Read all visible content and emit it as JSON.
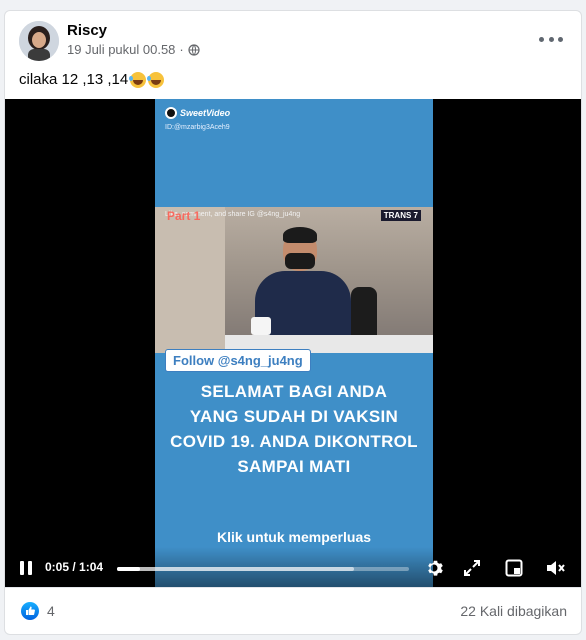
{
  "post": {
    "author": "Riscy",
    "timestamp": "19 Juli pukul 00.58",
    "privacy_icon": "globe-icon",
    "menu_icon": "more-options-icon",
    "text": "cilaka 12 ,13 ,14"
  },
  "video": {
    "brand": "SweetVideo",
    "brand_sub": "ID:@mzarbig3Aceh9",
    "clip_caption": "Like, comment, and share IG @s4ng_ju4ng",
    "clip_part": "Part 1",
    "clip_channel": "TRANS 7",
    "follow_label": "Follow @s4ng_ju4ng",
    "overlay_lines": [
      "SELAMAT BAGI ANDA",
      "YANG SUDAH DI VAKSIN",
      "COVID 19. ANDA DIKONTROL",
      "SAMPAI MATI"
    ],
    "expand_label": "Klik untuk memperluas",
    "time_label": "0:05 / 1:04",
    "progress_fraction": 0.078,
    "buffered_fraction": 0.81,
    "controls": {
      "pause_icon": "pause-icon",
      "settings_icon": "gear-icon",
      "fullscreen_icon": "fullscreen-icon",
      "pip_icon": "picture-in-picture-icon",
      "volume_icon": "mute-icon"
    }
  },
  "footer": {
    "like_icon": "thumbs-up-icon",
    "like_count": "4",
    "shares": "22 Kali dibagikan"
  },
  "colors": {
    "accent": "#1877f2",
    "video_panel": "#3f8fc8",
    "meta_text": "#65676b"
  }
}
